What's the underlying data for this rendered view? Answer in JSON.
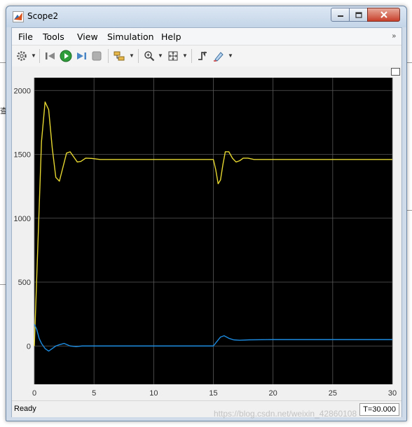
{
  "window": {
    "title": "Scope2"
  },
  "menu": {
    "items": [
      "File",
      "Tools",
      "View",
      "Simulation",
      "Help"
    ],
    "overflow_icon": "chevron-double-right-icon"
  },
  "toolbar": {
    "icons": [
      "gear-icon",
      "step-back-icon",
      "run-icon",
      "step-forward-icon",
      "stop-icon",
      "signal-select-icon",
      "zoom-icon",
      "autoscale-icon",
      "trigger-icon",
      "highlight-icon"
    ]
  },
  "chart_data": {
    "type": "line",
    "xlim": [
      0,
      30
    ],
    "ylim": [
      -300,
      2100
    ],
    "xticks": [
      "0",
      "5",
      "10",
      "15",
      "20",
      "25",
      "30"
    ],
    "yticks": [
      "0",
      "500",
      "1000",
      "1500",
      "2000"
    ],
    "grid": true,
    "background": "#000000",
    "series": [
      {
        "color": "#e5d630",
        "x": [
          0,
          0.3,
          0.6,
          0.9,
          1.2,
          1.5,
          1.8,
          2.1,
          2.4,
          2.7,
          3.0,
          3.3,
          3.6,
          3.9,
          4.3,
          4.8,
          5.5,
          7,
          15,
          15.2,
          15.4,
          15.6,
          15.8,
          16.0,
          16.3,
          16.6,
          16.9,
          17.2,
          17.5,
          17.9,
          18.4,
          19.2,
          22,
          30
        ],
        "y": [
          0,
          800,
          1600,
          1910,
          1850,
          1550,
          1320,
          1290,
          1400,
          1510,
          1520,
          1480,
          1440,
          1445,
          1470,
          1468,
          1460,
          1460,
          1460,
          1380,
          1270,
          1300,
          1420,
          1520,
          1520,
          1470,
          1440,
          1450,
          1470,
          1470,
          1460,
          1460,
          1460,
          1460
        ]
      },
      {
        "color": "#1c8be0",
        "x": [
          0,
          0.2,
          0.4,
          0.6,
          0.9,
          1.2,
          1.5,
          1.8,
          2.1,
          2.5,
          3.0,
          3.5,
          4.0,
          5,
          7,
          15,
          15.3,
          15.6,
          15.9,
          16.3,
          16.7,
          17.2,
          18,
          20,
          30
        ],
        "y": [
          170,
          130,
          60,
          20,
          -20,
          -40,
          -20,
          0,
          10,
          20,
          0,
          -5,
          0,
          0,
          0,
          0,
          35,
          70,
          80,
          60,
          48,
          45,
          48,
          50,
          50
        ]
      }
    ]
  },
  "status": {
    "text": "Ready",
    "time": "T=30.000"
  },
  "watermark": "https://blog.csdn.net/weixin_42860108",
  "background_text": "查"
}
